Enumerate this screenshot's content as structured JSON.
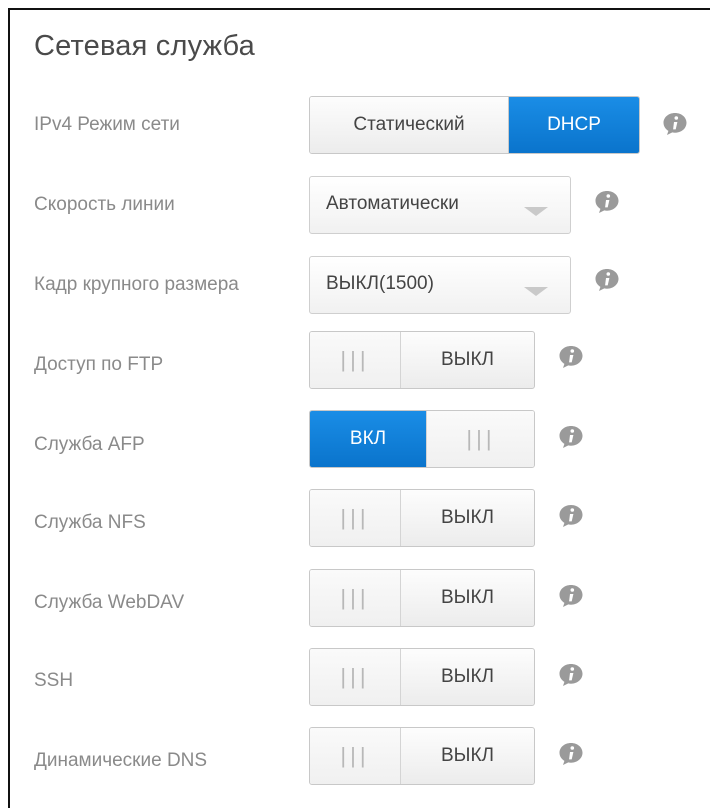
{
  "title": "Сетевая служба",
  "network_mode": {
    "label": "IPv4 Режим сети",
    "options": [
      "Статический",
      "DHCP"
    ],
    "selected": "DHCP",
    "info_icon": "info-icon"
  },
  "link_speed": {
    "label": "Скорость линии",
    "value": "Автоматически",
    "info_icon": "info-icon"
  },
  "jumbo_frame": {
    "label": "Кадр крупного размера",
    "value": "ВЫКЛ(1500)",
    "info_icon": "info-icon"
  },
  "toggles": [
    {
      "label": "Доступ по FTP",
      "state": "ВЫКЛ",
      "on": false
    },
    {
      "label": "Служба AFP",
      "state": "ВКЛ",
      "on": true
    },
    {
      "label": "Служба NFS",
      "state": "ВЫКЛ",
      "on": false
    },
    {
      "label": "Служба WebDAV",
      "state": "ВЫКЛ",
      "on": false
    },
    {
      "label": "SSH",
      "state": "ВЫКЛ",
      "on": false
    },
    {
      "label": "Динамические DNS",
      "state": "ВЫКЛ",
      "on": false
    }
  ],
  "grip_glyph": "|||",
  "colors": {
    "accent": "#0a7fd9",
    "label": "#8a8a8a",
    "info_icon": "#9a9a9a"
  }
}
